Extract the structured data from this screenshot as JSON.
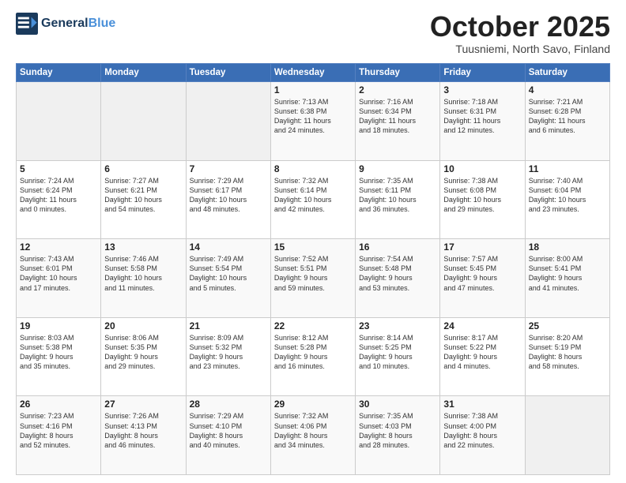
{
  "header": {
    "logo_line1": "General",
    "logo_line2": "Blue",
    "month": "October 2025",
    "location": "Tuusniemi, North Savo, Finland"
  },
  "days_of_week": [
    "Sunday",
    "Monday",
    "Tuesday",
    "Wednesday",
    "Thursday",
    "Friday",
    "Saturday"
  ],
  "weeks": [
    [
      {
        "day": "",
        "info": ""
      },
      {
        "day": "",
        "info": ""
      },
      {
        "day": "",
        "info": ""
      },
      {
        "day": "1",
        "info": "Sunrise: 7:13 AM\nSunset: 6:38 PM\nDaylight: 11 hours\nand 24 minutes."
      },
      {
        "day": "2",
        "info": "Sunrise: 7:16 AM\nSunset: 6:34 PM\nDaylight: 11 hours\nand 18 minutes."
      },
      {
        "day": "3",
        "info": "Sunrise: 7:18 AM\nSunset: 6:31 PM\nDaylight: 11 hours\nand 12 minutes."
      },
      {
        "day": "4",
        "info": "Sunrise: 7:21 AM\nSunset: 6:28 PM\nDaylight: 11 hours\nand 6 minutes."
      }
    ],
    [
      {
        "day": "5",
        "info": "Sunrise: 7:24 AM\nSunset: 6:24 PM\nDaylight: 11 hours\nand 0 minutes."
      },
      {
        "day": "6",
        "info": "Sunrise: 7:27 AM\nSunset: 6:21 PM\nDaylight: 10 hours\nand 54 minutes."
      },
      {
        "day": "7",
        "info": "Sunrise: 7:29 AM\nSunset: 6:17 PM\nDaylight: 10 hours\nand 48 minutes."
      },
      {
        "day": "8",
        "info": "Sunrise: 7:32 AM\nSunset: 6:14 PM\nDaylight: 10 hours\nand 42 minutes."
      },
      {
        "day": "9",
        "info": "Sunrise: 7:35 AM\nSunset: 6:11 PM\nDaylight: 10 hours\nand 36 minutes."
      },
      {
        "day": "10",
        "info": "Sunrise: 7:38 AM\nSunset: 6:08 PM\nDaylight: 10 hours\nand 29 minutes."
      },
      {
        "day": "11",
        "info": "Sunrise: 7:40 AM\nSunset: 6:04 PM\nDaylight: 10 hours\nand 23 minutes."
      }
    ],
    [
      {
        "day": "12",
        "info": "Sunrise: 7:43 AM\nSunset: 6:01 PM\nDaylight: 10 hours\nand 17 minutes."
      },
      {
        "day": "13",
        "info": "Sunrise: 7:46 AM\nSunset: 5:58 PM\nDaylight: 10 hours\nand 11 minutes."
      },
      {
        "day": "14",
        "info": "Sunrise: 7:49 AM\nSunset: 5:54 PM\nDaylight: 10 hours\nand 5 minutes."
      },
      {
        "day": "15",
        "info": "Sunrise: 7:52 AM\nSunset: 5:51 PM\nDaylight: 9 hours\nand 59 minutes."
      },
      {
        "day": "16",
        "info": "Sunrise: 7:54 AM\nSunset: 5:48 PM\nDaylight: 9 hours\nand 53 minutes."
      },
      {
        "day": "17",
        "info": "Sunrise: 7:57 AM\nSunset: 5:45 PM\nDaylight: 9 hours\nand 47 minutes."
      },
      {
        "day": "18",
        "info": "Sunrise: 8:00 AM\nSunset: 5:41 PM\nDaylight: 9 hours\nand 41 minutes."
      }
    ],
    [
      {
        "day": "19",
        "info": "Sunrise: 8:03 AM\nSunset: 5:38 PM\nDaylight: 9 hours\nand 35 minutes."
      },
      {
        "day": "20",
        "info": "Sunrise: 8:06 AM\nSunset: 5:35 PM\nDaylight: 9 hours\nand 29 minutes."
      },
      {
        "day": "21",
        "info": "Sunrise: 8:09 AM\nSunset: 5:32 PM\nDaylight: 9 hours\nand 23 minutes."
      },
      {
        "day": "22",
        "info": "Sunrise: 8:12 AM\nSunset: 5:28 PM\nDaylight: 9 hours\nand 16 minutes."
      },
      {
        "day": "23",
        "info": "Sunrise: 8:14 AM\nSunset: 5:25 PM\nDaylight: 9 hours\nand 10 minutes."
      },
      {
        "day": "24",
        "info": "Sunrise: 8:17 AM\nSunset: 5:22 PM\nDaylight: 9 hours\nand 4 minutes."
      },
      {
        "day": "25",
        "info": "Sunrise: 8:20 AM\nSunset: 5:19 PM\nDaylight: 8 hours\nand 58 minutes."
      }
    ],
    [
      {
        "day": "26",
        "info": "Sunrise: 7:23 AM\nSunset: 4:16 PM\nDaylight: 8 hours\nand 52 minutes."
      },
      {
        "day": "27",
        "info": "Sunrise: 7:26 AM\nSunset: 4:13 PM\nDaylight: 8 hours\nand 46 minutes."
      },
      {
        "day": "28",
        "info": "Sunrise: 7:29 AM\nSunset: 4:10 PM\nDaylight: 8 hours\nand 40 minutes."
      },
      {
        "day": "29",
        "info": "Sunrise: 7:32 AM\nSunset: 4:06 PM\nDaylight: 8 hours\nand 34 minutes."
      },
      {
        "day": "30",
        "info": "Sunrise: 7:35 AM\nSunset: 4:03 PM\nDaylight: 8 hours\nand 28 minutes."
      },
      {
        "day": "31",
        "info": "Sunrise: 7:38 AM\nSunset: 4:00 PM\nDaylight: 8 hours\nand 22 minutes."
      },
      {
        "day": "",
        "info": ""
      }
    ]
  ]
}
